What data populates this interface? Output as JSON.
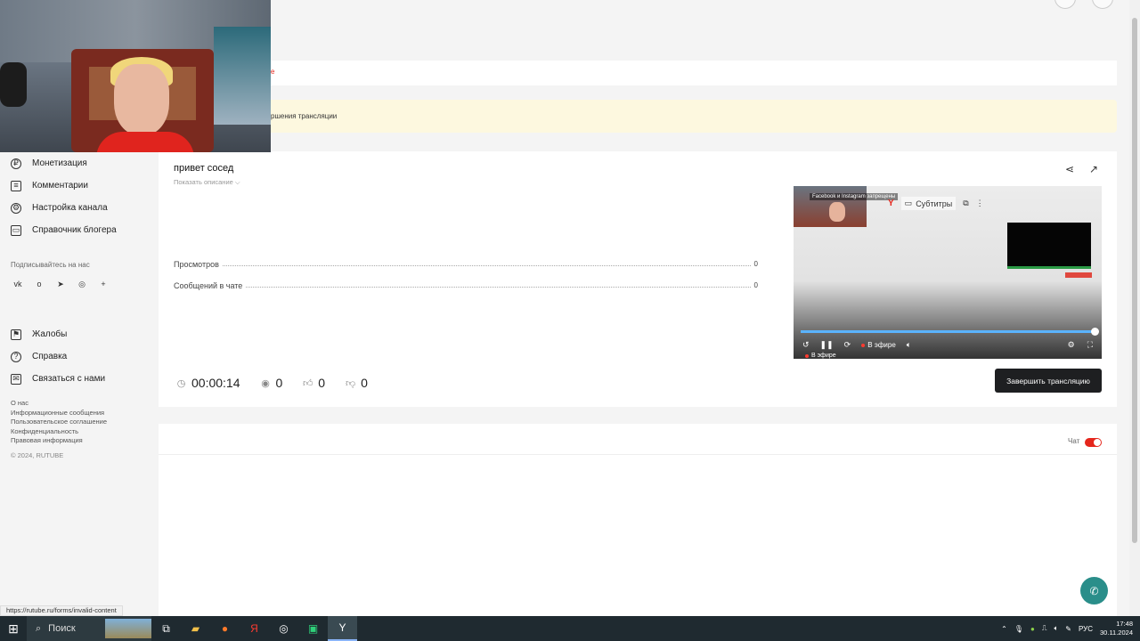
{
  "tabstrip": {
    "red_text": "е"
  },
  "notice": {
    "text": "ршения трансляции"
  },
  "sidebar": {
    "items": [
      {
        "label": "Монетизация",
        "icon": "ruble-icon"
      },
      {
        "label": "Комментарии",
        "icon": "comment-icon"
      },
      {
        "label": "Настройка канала",
        "icon": "gear-icon"
      },
      {
        "label": "Справочник блогера",
        "icon": "book-icon"
      }
    ],
    "subscribe_label": "Подписывайтесь на нас",
    "socials": [
      "vk",
      "ok",
      "telegram",
      "viber",
      "+"
    ],
    "items2": [
      {
        "label": "Жалобы",
        "icon": "flag-icon"
      },
      {
        "label": "Справка",
        "icon": "help-icon"
      },
      {
        "label": "Связаться с нами",
        "icon": "mail-icon"
      }
    ],
    "footer_links": [
      "О нас",
      "Информационные сообщения",
      "Пользовательское соглашение",
      "Конфиденциальность",
      "Правовая информация"
    ],
    "copyright": "© 2024, RUTUBE"
  },
  "stream": {
    "title": "привет сосед",
    "show_description": "Показать описание",
    "stats": [
      {
        "label": "Просмотров",
        "value": "0"
      },
      {
        "label": "Сообщений в чате",
        "value": "0"
      }
    ],
    "duration": "00:00:14",
    "viewers": "0",
    "likes": "0",
    "dislikes": "0",
    "end_button": "Завершить трансляцию"
  },
  "player": {
    "cam_label": "Facebook и Instagram запрещены",
    "subtitles": "Субтитры",
    "live_label": "В эфире",
    "live_label_left": "В эфире"
  },
  "chat": {
    "label": "Чат",
    "enabled": true
  },
  "status_url": "https://rutube.ru/forms/invalid-content",
  "taskbar": {
    "search": "Поиск",
    "lang": "РУС",
    "time": "17:48",
    "date": "30.11.2024"
  },
  "colors": {
    "accent": "#e5261c",
    "dark_button": "#1e1f21",
    "notice_bg": "#fdf8df",
    "support": "#2a8e8a"
  }
}
